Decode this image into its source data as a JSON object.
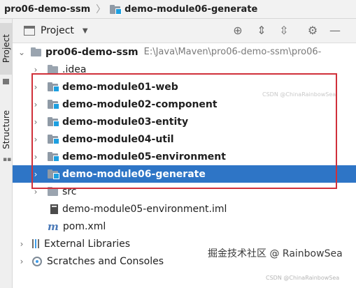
{
  "breadcrumb": {
    "project": "pro06-demo-ssm",
    "module": "demo-module06-generate"
  },
  "side_tabs": {
    "project": "Project",
    "structure": "Structure"
  },
  "panel": {
    "title": "Project",
    "tools": [
      "target-icon",
      "expand-all-icon",
      "collapse-all-icon",
      "gear-icon",
      "minimize-icon"
    ]
  },
  "tree": {
    "root": {
      "name": "pro06-demo-ssm",
      "path": "E:\\Java\\Maven\\pro06-demo-ssm\\pro06-"
    },
    "idea": ".idea",
    "modules": [
      "demo-module01-web",
      "demo-module02-component",
      "demo-module03-entity",
      "demo-module04-util",
      "demo-module05-environment",
      "demo-module06-generate"
    ],
    "selected_index": 5,
    "src": "src",
    "iml": "demo-module05-environment.iml",
    "pom": "pom.xml",
    "external_libraries": "External Libraries",
    "scratches": "Scratches and Consoles"
  },
  "watermark": {
    "main": "掘金技术社区 @ RainbowSea",
    "small": "CSDN @ChinaRainbowSea",
    "faint": "CSDN @ChinaRainbowSea"
  },
  "colors": {
    "selection": "#2e75c6",
    "highlight_box": "#d0303a",
    "module_badge": "#1d9fe0"
  }
}
